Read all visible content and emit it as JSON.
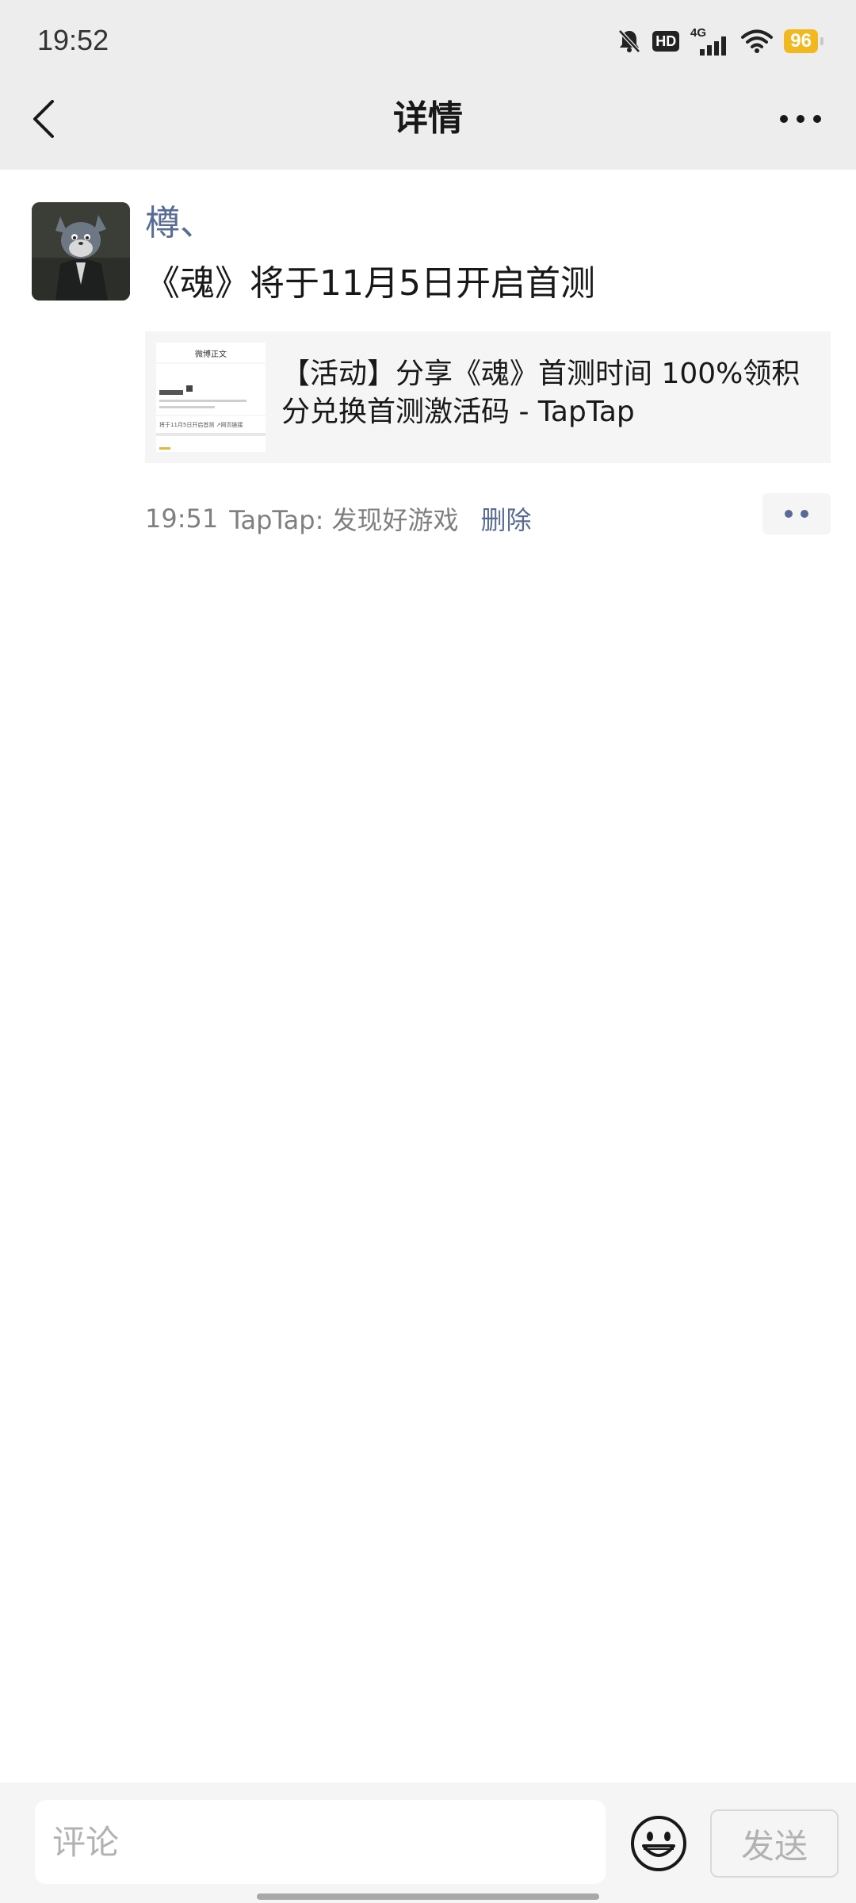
{
  "status_bar": {
    "time": "19:52",
    "hd_label": "HD",
    "network_label": "4G",
    "battery_level": "96",
    "icons": [
      "mute-bell-icon",
      "hd-icon",
      "signal-4g-icon",
      "wifi-icon",
      "battery-icon"
    ]
  },
  "header": {
    "title": "详情",
    "back_icon": "chevron-left-icon",
    "more_icon": "more-dots-icon"
  },
  "post": {
    "author": "樽、",
    "text": "《魂》将于11月5日开启首测",
    "link_card": {
      "title_line1": "【活动】分享《魂》首测时间 100%领积",
      "title_line2": "分兑换首测激活码 - TapTap",
      "thumb_heading": "微博正文",
      "thumb_caption": "将于11月5日开启首测 ↗网页链接"
    },
    "time": "19:51",
    "source": "TapTap: 发现好游戏",
    "delete_label": "删除"
  },
  "comment_bar": {
    "placeholder": "评论",
    "send_label": "发送",
    "emoji_icon": "smiley-face-icon"
  },
  "colors": {
    "header_bg": "#ededed",
    "link_blue": "#576b95",
    "text_dark": "#181818",
    "text_gray": "#7f7f7f",
    "battery": "#f2b820"
  }
}
